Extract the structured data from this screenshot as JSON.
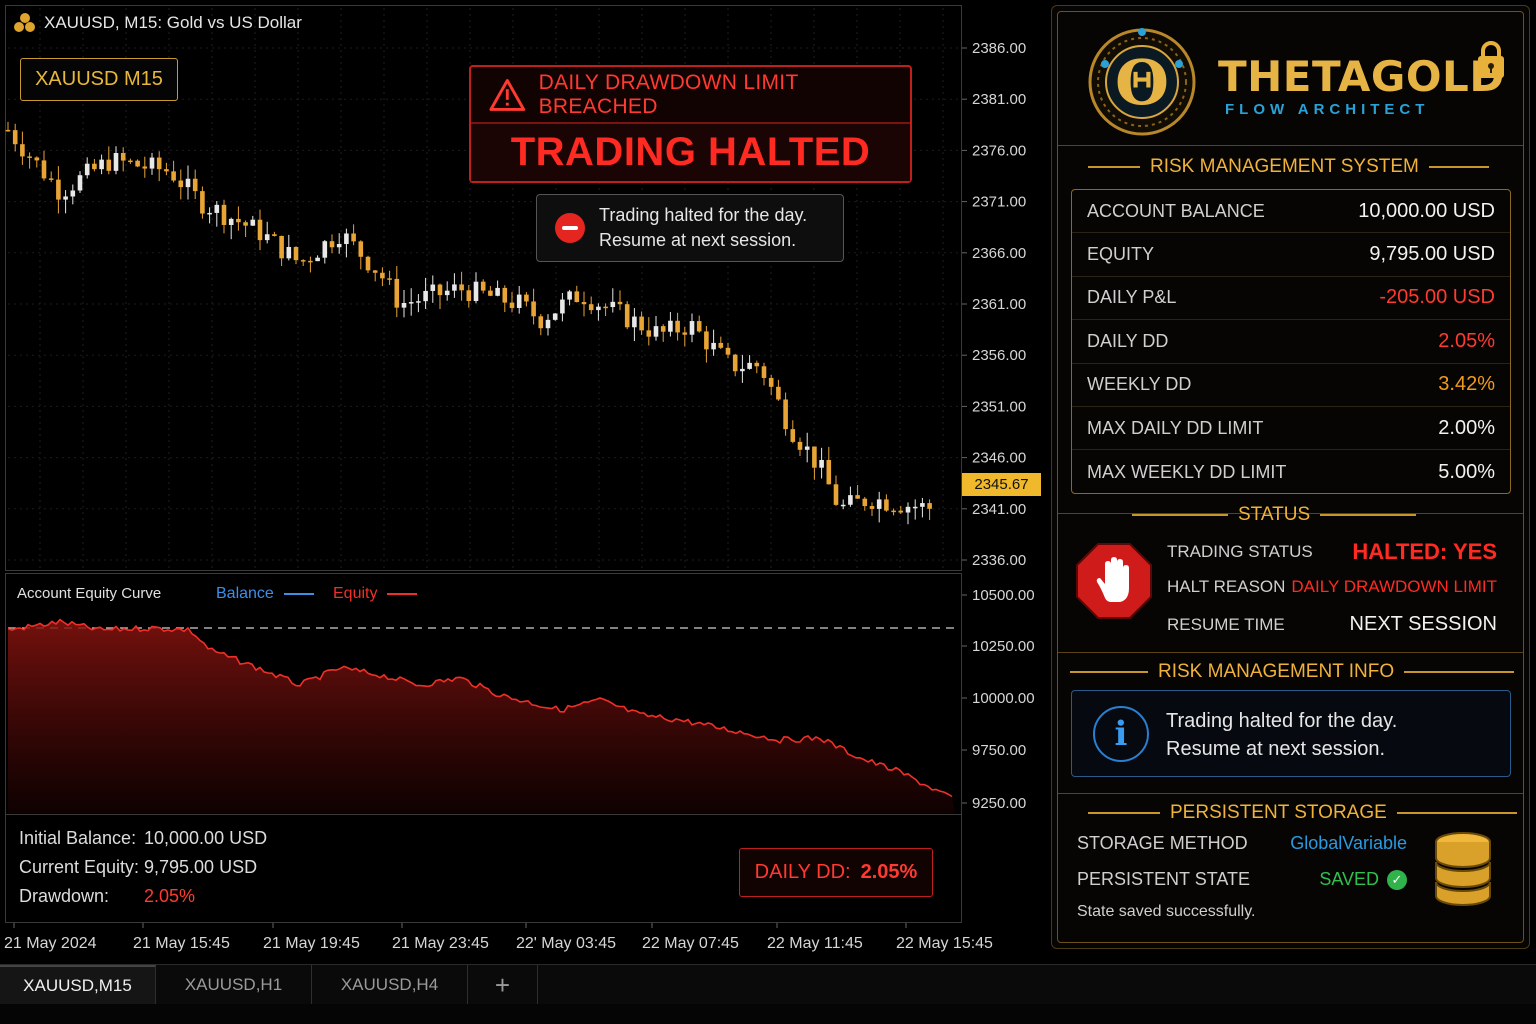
{
  "chart": {
    "title": "XAUUSD, M15:  Gold vs US Dollar",
    "symbol_badge": "XAUUSD M15",
    "price_tag": "2345.67",
    "price_axis": [
      "2386.00",
      "2381.00",
      "2376.00",
      "2371.00",
      "2366.00",
      "2361.00",
      "2356.00",
      "2351.00",
      "2346.00",
      "2341.00",
      "2336.00"
    ],
    "equity_axis": [
      "10500.00",
      "10250.00",
      "10000.00",
      "9750.00",
      "9250.00"
    ],
    "time_axis": [
      "21 May 2024",
      "21 May 15:45",
      "21 May 19:45",
      "21 May 23:45",
      "22' May 03:45",
      "22 May 07:45",
      "22 May 11:45",
      "22 May 15:45"
    ]
  },
  "alert": {
    "header": "DAILY DRAWDOWN LIMIT BREACHED",
    "main": "TRADING HALTED",
    "toast_line1": "Trading halted for the day.",
    "toast_line2": "Resume at next session."
  },
  "equity_panel": {
    "title": "Account Equity Curve",
    "legend_balance": "Balance",
    "legend_equity": "Equity"
  },
  "stats": {
    "initial_label": "Initial Balance:",
    "initial_value": "10,000.00 USD",
    "equity_label": "Current Equity:",
    "equity_value": "9,795.00 USD",
    "drawdown_label": "Drawdown:",
    "drawdown_value": "2.05%",
    "badge_label": "DAILY DD:",
    "badge_value": "2.05%"
  },
  "tabs": [
    "XAUUSD,M15",
    "XAUUSD,H1",
    "XAUUSD,H4",
    "+"
  ],
  "panel": {
    "brand_name": "THETAGOLD",
    "brand_sub": "FLOW ARCHITECT",
    "brand_emblem_letter": "Θ",
    "risk_heading": "RISK MANAGEMENT SYSTEM",
    "risk_rows": [
      {
        "label": "ACCOUNT BALANCE",
        "value": "10,000.00 USD",
        "color": "#f2f2f2"
      },
      {
        "label": "EQUITY",
        "value": "9,795.00 USD",
        "color": "#f2f2f2"
      },
      {
        "label": "DAILY P&L",
        "value": "-205.00 USD",
        "color": "#ff3a30"
      },
      {
        "label": "DAILY DD",
        "value": "2.05%",
        "color": "#ff3a30"
      },
      {
        "label": "WEEKLY DD",
        "value": "3.42%",
        "color": "#f29a1c"
      },
      {
        "label": "MAX DAILY DD LIMIT",
        "value": "2.00%",
        "color": "#f2f2f2"
      },
      {
        "label": "MAX WEEKLY DD LIMIT",
        "value": "5.00%",
        "color": "#f2f2f2"
      }
    ],
    "status_heading": "STATUS",
    "trading_status_label": "TRADING STATUS",
    "trading_status_value": "HALTED: YES",
    "halt_reason_label": "HALT REASON",
    "halt_reason_value": "DAILY DRAWDOWN LIMIT",
    "resume_time_label": "RESUME TIME",
    "resume_time_value": "NEXT SESSION",
    "info_heading": "RISK MANAGEMENT INFO",
    "info_line1": "Trading halted for the day.",
    "info_line2": "Resume at next session.",
    "info_icon": "i",
    "storage_heading": "PERSISTENT STORAGE",
    "storage_method_label": "STORAGE METHOD",
    "storage_method_value": "GlobalVariable",
    "persistent_state_label": "PERSISTENT STATE",
    "persistent_state_value": "SAVED",
    "check_glyph": "✓",
    "saved_message": "State saved successfully."
  },
  "colors": {
    "gold": "#f0b23a",
    "red": "#ff3a30",
    "blue": "#2aa2d8",
    "green": "#2fb34a",
    "candle_up": "#e8e8e8",
    "candle_down": "#e8a435"
  },
  "icons": [
    "gold-logo-icon",
    "warning-triangle-icon",
    "no-entry-icon",
    "lock-icon",
    "stop-hand-icon",
    "info-icon",
    "check-icon",
    "database-icon"
  ]
}
